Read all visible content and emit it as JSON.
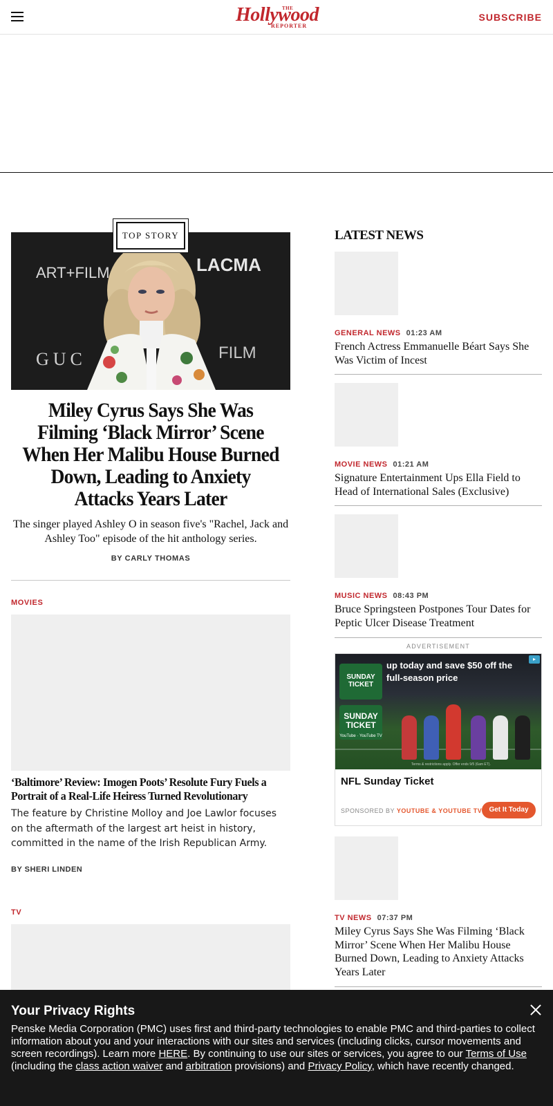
{
  "header": {
    "logo_the": "THE",
    "logo_name": "Hollywood",
    "logo_reporter": "REPORTER",
    "subscribe_label": "SUBSCRIBE"
  },
  "top_story": {
    "badge": "TOP STORY",
    "headline": "Miley Cyrus Says She Was Filming ‘Black Mirror’ Scene When Her Malibu House Burned Down, Leading to Anxiety Attacks Years Later",
    "dek": "The singer played Ashley O in season five's \"Rachel, Jack and Ashley Too\" episode of the hit anthology series.",
    "byline": "BY CARLY THOMAS",
    "image_backdrop": {
      "left": "ART+FILM",
      "right": "LACMA",
      "bottom_left": "GUC",
      "bottom_right": "FILM"
    }
  },
  "movies_section": {
    "category": "MOVIES",
    "headline": "‘Baltimore’ Review: Imogen Poots’ Resolute Fury Fuels a Portrait of a Real-Life Heiress Turned Revolutionary",
    "dek": "The feature by Christine Molloy and Joe Lawlor focuses on the aftermath of the largest art heist in history, committed in the name of the Irish Republican Army.",
    "byline": "BY SHERI LINDEN"
  },
  "tv_section": {
    "category": "TV"
  },
  "latest_news": {
    "title": "LATEST NEWS",
    "items": [
      {
        "category": "GENERAL NEWS",
        "time": "01:23 AM",
        "headline": "French Actress Emmanuelle Béart Says She Was Victim of Incest"
      },
      {
        "category": "MOVIE NEWS",
        "time": "01:21 AM",
        "headline": "Signature Entertainment Ups Ella Field to Head of International Sales (Exclusive)"
      },
      {
        "category": "MUSIC NEWS",
        "time": "08:43 PM",
        "headline": "Bruce Springsteen Postpones Tour Dates for Peptic Ulcer Disease Treatment"
      },
      {
        "category": "TV NEWS",
        "time": "07:37 PM",
        "headline": "Miley Cyrus Says She Was Filming ‘Black Mirror’ Scene When Her Malibu House Burned Down, Leading to Anxiety Attacks Years Later"
      }
    ]
  },
  "advertisement": {
    "label": "ADVERTISEMENT",
    "image_text": "up today and save $50 off the full-season price",
    "badge_text": "SUNDAY TICKET",
    "badge_sub": "YouTube · YouTube TV",
    "fine_print": "Terms & restrictions apply. Offer ends 9/5 (6am ET).",
    "name": "NFL Sunday Ticket",
    "sponsor_prefix": "SPONSORED BY",
    "sponsor_brand": "YOUTUBE & YOUTUBE TV",
    "cta": "Get It Today"
  },
  "privacy": {
    "title": "Your Privacy Rights",
    "text_1": "Penske Media Corporation (PMC) uses first and third-party technologies to enable PMC and third-parties to collect information about you and your interactions with our sites and services (including clicks, cursor movements and screen recordings). Learn more ",
    "link_here": "HERE",
    "text_2": ". By continuing to use our sites or services, you agree to our ",
    "link_terms": "Terms of Use",
    "text_3": " (including the ",
    "link_class_action": "class action waiver",
    "text_4": " and ",
    "link_arbitration": "arbitration",
    "text_5": " provisions) and ",
    "link_privacy_policy": "Privacy Policy",
    "text_6": ", which have recently changed."
  },
  "colors": {
    "accent_red": "#c1272d",
    "ad_orange": "#e4572e",
    "banner_bg": "#181818",
    "placeholder": "#efefef"
  },
  "icons": {
    "menu": "hamburger-icon",
    "close": "close-icon"
  }
}
